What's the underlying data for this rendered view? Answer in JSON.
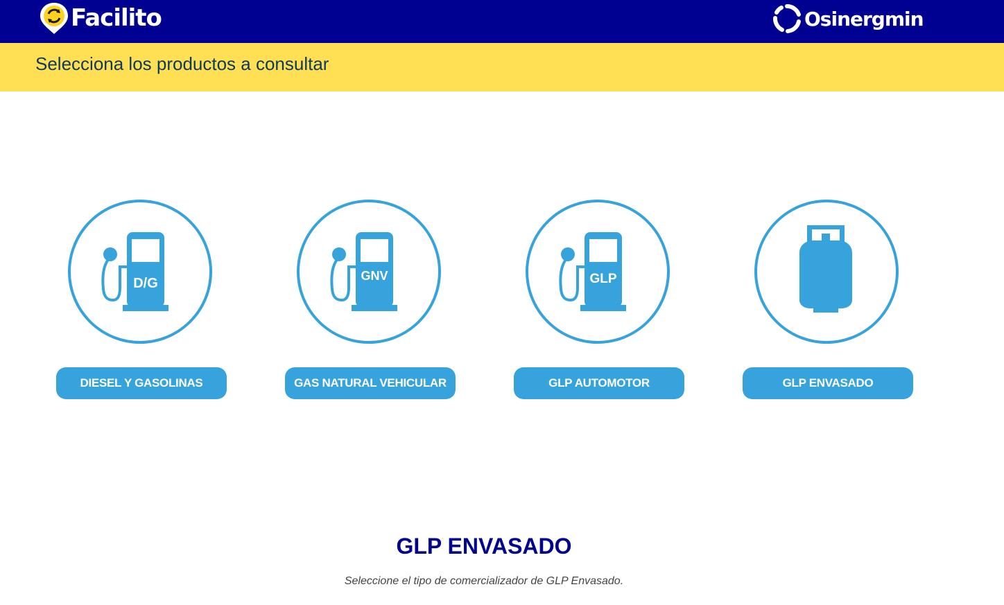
{
  "header": {
    "brand_left": "Facilito",
    "brand_right": "Osinergmin",
    "background_color": "#000091"
  },
  "banner": {
    "heading": "Selecciona los productos a consultar",
    "background_color": "#ffdf54"
  },
  "products": [
    {
      "icon": "fuel-pump-icon",
      "icon_label": "D/G",
      "button_label": "DIESEL Y GASOLINAS"
    },
    {
      "icon": "fuel-pump-icon",
      "icon_label": "GNV",
      "button_label": "GAS NATURAL VEHICULAR"
    },
    {
      "icon": "fuel-pump-icon",
      "icon_label": "GLP",
      "button_label": "GLP AUTOMOTOR"
    },
    {
      "icon": "gas-cylinder-icon",
      "icon_label": "",
      "button_label": "GLP ENVASADO"
    }
  ],
  "section": {
    "title": "GLP ENVASADO",
    "subtitle": "Seleccione el tipo de comercializador de GLP Envasado."
  },
  "colors": {
    "accent": "#36a3dd",
    "title": "#000091"
  }
}
